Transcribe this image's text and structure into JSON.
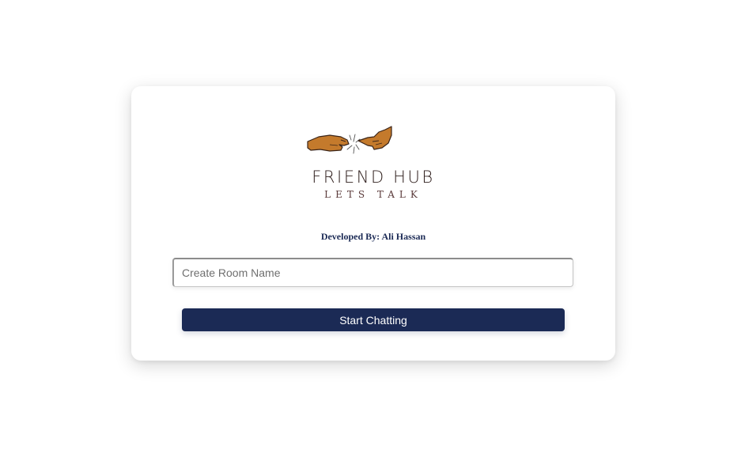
{
  "logo": {
    "icon": "reaching-hands-icon",
    "title": "FRIEND HUB",
    "subtitle": "LETS TALK"
  },
  "developer_credit": "Developed By: Ali Hassan",
  "room_input": {
    "value": "",
    "placeholder": "Create Room Name"
  },
  "start_button": {
    "label": "Start Chatting"
  },
  "colors": {
    "primary": "#1b2a55",
    "hand": "#c47a2c",
    "background": "#ffffff"
  }
}
